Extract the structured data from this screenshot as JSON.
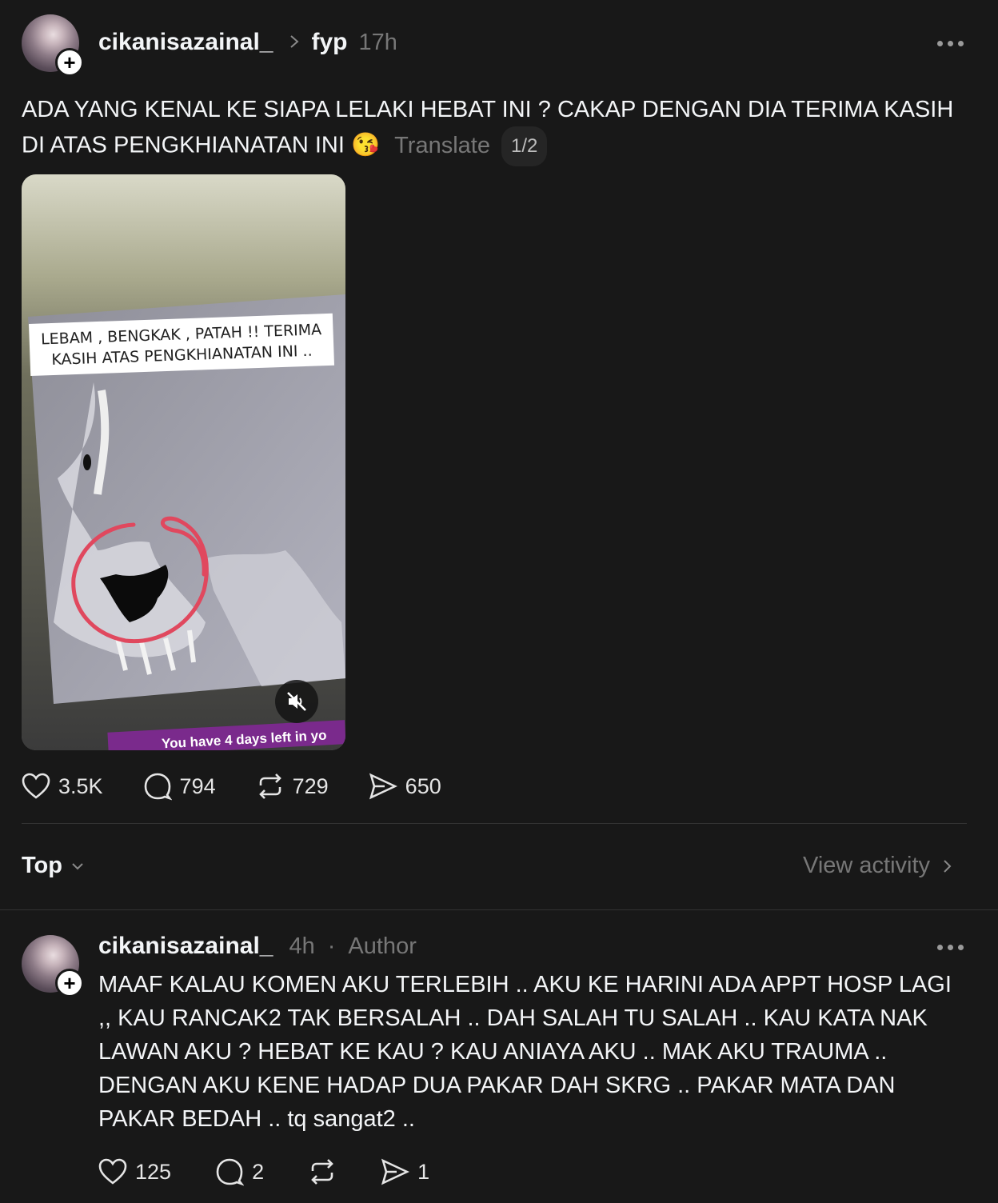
{
  "post": {
    "username": "cikanisazainal_",
    "separator": ">",
    "topic": "fyp",
    "time": "17h",
    "text": "ADA YANG KENAL KE SIAPA LELAKI HEBAT INI ? CAKAP DENGAN DIA TERIMA KASIH DI ATAS PENGKHIANATAN INI",
    "emoji": "😘",
    "translate": "Translate",
    "pager": "1/2",
    "media": {
      "caption_line1": "LEBAM , BENGKAK , PATAH !! TERIMA",
      "caption_line2": "KASIH ATAS PENGKHIANATAN INI ..",
      "banner": "You have 4 days left in yo"
    },
    "stats": {
      "likes": "3.5K",
      "comments": "794",
      "reposts": "729",
      "shares": "650"
    }
  },
  "sort": {
    "label": "Top",
    "view_activity": "View activity"
  },
  "comment": {
    "username": "cikanisazainal_",
    "time": "4h",
    "dot": "·",
    "badge": "Author",
    "text": "MAAF KALAU KOMEN AKU TERLEBIH .. AKU KE HARINI ADA APPT HOSP LAGI ,, KAU RANCAK2 TAK BERSALAH .. DAH SALAH TU SALAH .. KAU KATA NAK LAWAN AKU ? HEBAT KE KAU ? KAU ANIAYA AKU .. MAK AKU TRAUMA .. DENGAN AKU KENE HADAP DUA PAKAR DAH SKRG .. PAKAR MATA DAN PAKAR BEDAH .. tq sangat2 ..",
    "stats": {
      "likes": "125",
      "comments": "2",
      "shares": "1"
    }
  },
  "colors": {
    "background": "#181818",
    "text": "#f3f5f7",
    "muted": "#777777",
    "circle_annotation": "#e0485e",
    "banner": "#7a2a8c"
  }
}
